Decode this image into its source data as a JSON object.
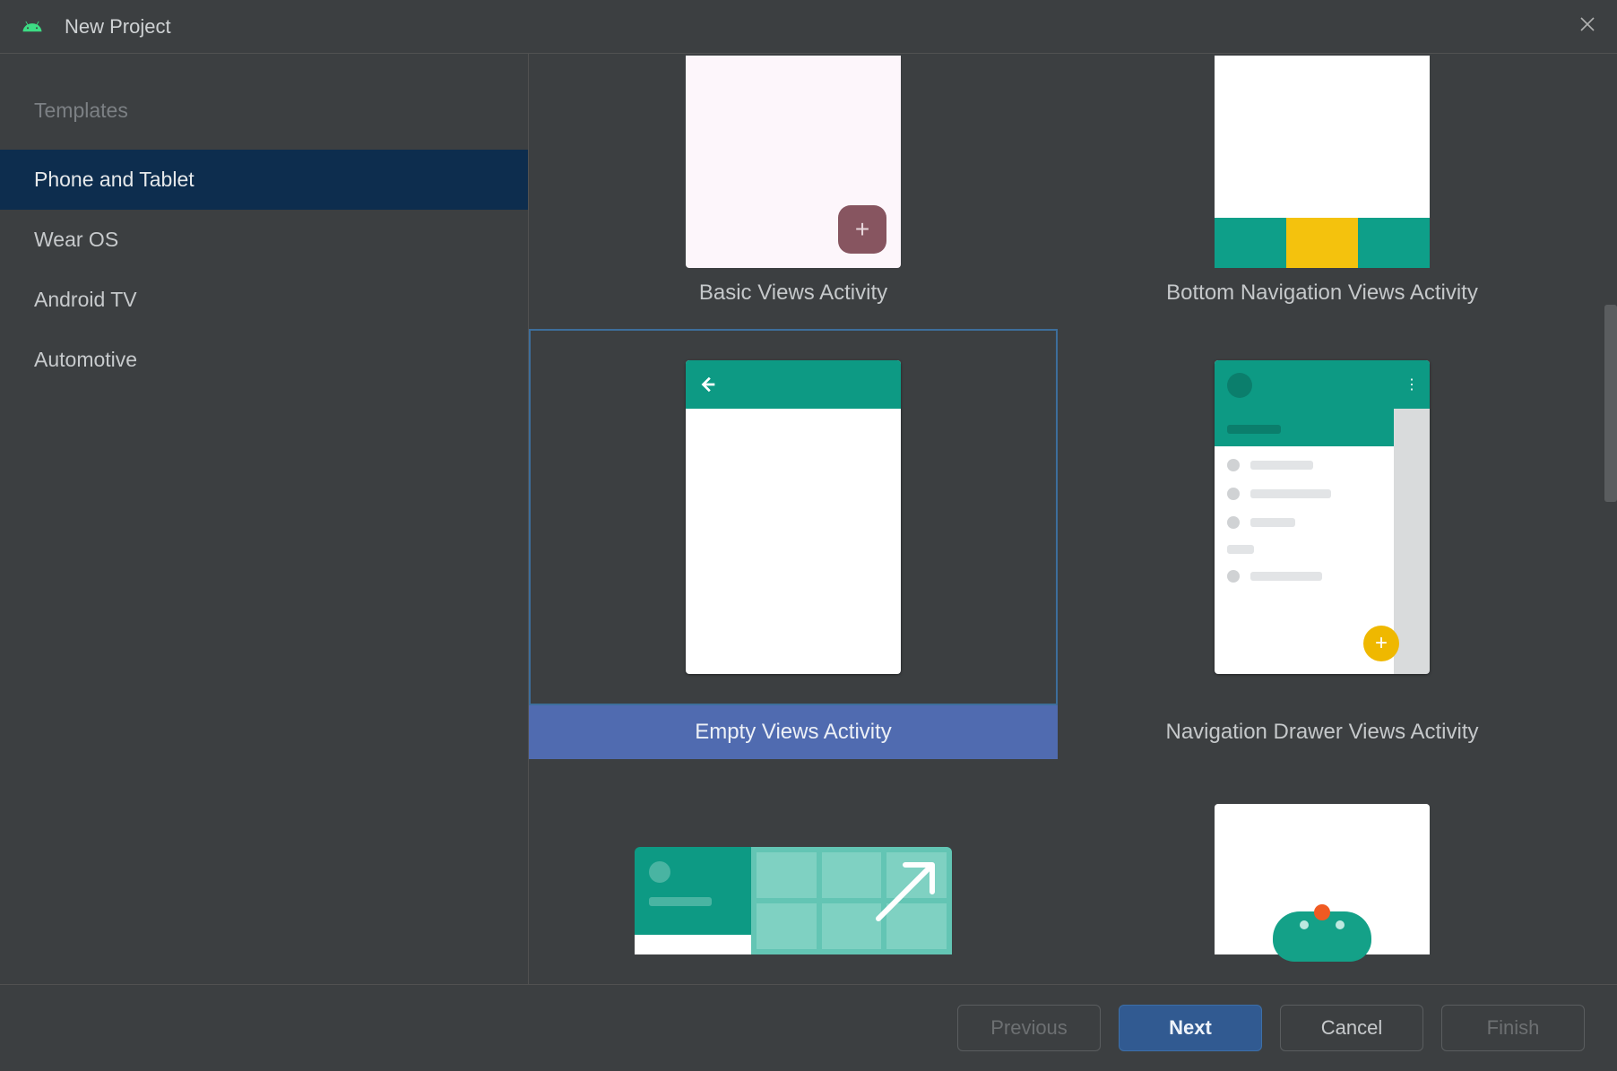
{
  "window": {
    "title": "New Project"
  },
  "sidebar": {
    "heading": "Templates",
    "items": [
      {
        "label": "Phone and Tablet",
        "selected": true
      },
      {
        "label": "Wear OS",
        "selected": false
      },
      {
        "label": "Android TV",
        "selected": false
      },
      {
        "label": "Automotive",
        "selected": false
      }
    ]
  },
  "templates": {
    "row0": [
      {
        "label": "Basic Views Activity",
        "selected": false
      },
      {
        "label": "Bottom Navigation Views Activity",
        "selected": false
      }
    ],
    "row1": [
      {
        "label": "Empty Views Activity",
        "selected": true
      },
      {
        "label": "Navigation Drawer Views Activity",
        "selected": false
      }
    ]
  },
  "footer": {
    "previous": "Previous",
    "next": "Next",
    "cancel": "Cancel",
    "finish": "Finish"
  }
}
